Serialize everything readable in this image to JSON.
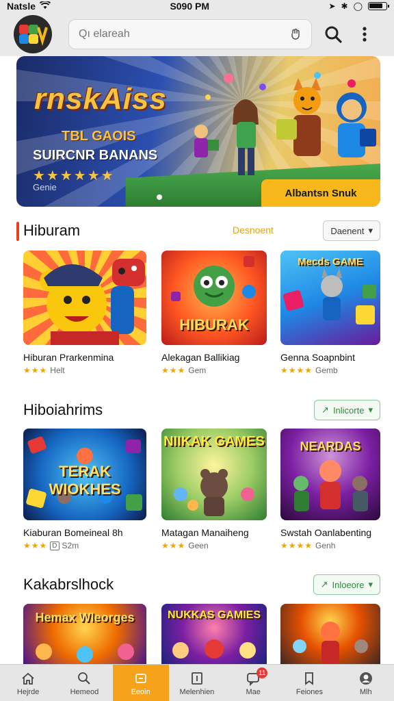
{
  "status_bar": {
    "carrier": "Natsle",
    "time": "S090 PM",
    "battery_level": 0.85
  },
  "search": {
    "placeholder": "Qı elareah"
  },
  "hero": {
    "title": "rnskAiss",
    "subtitle": "TBL GAOIS",
    "subtitle2": "SUIRCNR BANANS",
    "stars": "★★★★★★",
    "caption": "Genie",
    "cta": "Albantsn Snuk",
    "colors": {
      "cta": "#f6b81a",
      "title": "#f6c343"
    }
  },
  "sections": [
    {
      "title": "Hiburam",
      "link": "Desnoent",
      "dropdown": "Daenent",
      "has_accent": true,
      "cards": [
        {
          "title": "Hiburan Prarkenmina",
          "stars": "★★★",
          "badge": "",
          "meta": "Helt",
          "thumb_label": "",
          "thumb": "orange-rays"
        },
        {
          "title": "Alekagan Ballikiag",
          "stars": "★★★",
          "badge": "",
          "meta": "Gem",
          "thumb_label": "HIBURAK",
          "thumb": "red-monster"
        },
        {
          "title": "Genna Soapnbint",
          "stars": "★★★★",
          "badge": "",
          "meta": "Gemb",
          "thumb_label": "Mecds GAME",
          "thumb": "blue-cubes"
        }
      ]
    },
    {
      "title": "Hiboiahrims",
      "link": "",
      "dropdown": "Inlicorte",
      "has_accent": false,
      "cards": [
        {
          "title": "Kiaburan Bomeineal 8h",
          "stars": "★★★",
          "badge": "D",
          "meta": "S2m",
          "thumb_label": "TERAK WIOKHES",
          "thumb": "blue-bricks"
        },
        {
          "title": "Matagan Manaiheng",
          "stars": "★★★",
          "badge": "",
          "meta": "Geen",
          "thumb_label": "NIIKAK GAMES",
          "thumb": "green-bear"
        },
        {
          "title": "Swstah Oanlabenting",
          "stars": "★★★★",
          "badge": "",
          "meta": "Genh",
          "thumb_label": "NEARDAS",
          "thumb": "purple-crowd"
        }
      ]
    },
    {
      "title": "Kakabrslhock",
      "link": "",
      "dropdown": "Inloeore",
      "has_accent": false,
      "cards": [
        {
          "title": "",
          "stars": "",
          "badge": "",
          "meta": "",
          "thumb_label": "Hemax Wleorges",
          "thumb": "blue-hero"
        },
        {
          "title": "",
          "stars": "",
          "badge": "",
          "meta": "",
          "thumb_label": "NUKKAS GAMIES",
          "thumb": "purple-heroes"
        },
        {
          "title": "",
          "stars": "",
          "badge": "",
          "meta": "",
          "thumb_label": "",
          "thumb": "fire-crowd"
        }
      ]
    }
  ],
  "bottom_nav": [
    {
      "label": "Hejrde",
      "icon": "home-icon"
    },
    {
      "label": "Hemeod",
      "icon": "search-icon"
    },
    {
      "label": "Eeoin",
      "icon": "game-icon",
      "active": true
    },
    {
      "label": "Melenhien",
      "icon": "library-icon"
    },
    {
      "label": "Mae",
      "icon": "message-icon",
      "badge": "11"
    },
    {
      "label": "Feiones",
      "icon": "bookmark-icon"
    },
    {
      "label": "Mlh",
      "icon": "profile-icon"
    }
  ]
}
